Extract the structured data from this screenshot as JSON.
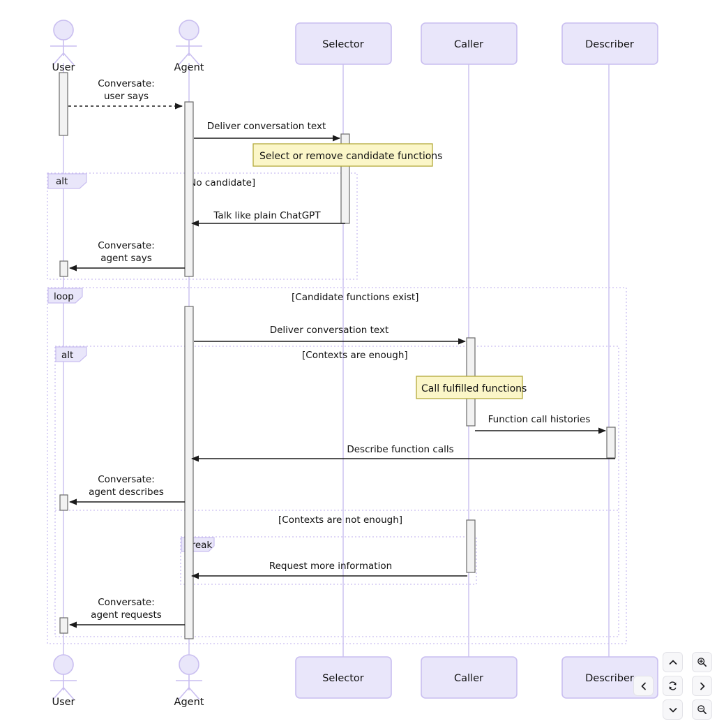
{
  "diagram": {
    "type": "uml-sequence-diagram",
    "colors": {
      "participant_fill": "#e9e6fa",
      "participant_stroke": "#c6bdf0",
      "lifeline_stroke": "#c9bef0",
      "activation_fill": "#f2f2f2",
      "activation_stroke": "#6b6b6b",
      "note_fill": "#fbf6c8",
      "note_stroke": "#b3a93a",
      "fragment_stroke": "#c9bef0",
      "fragment_label_fill": "#e9e6fa",
      "message_stroke": "#1a1a1a",
      "text": "#111111"
    },
    "participants": [
      {
        "name": "User",
        "label": "User",
        "shape": "actor"
      },
      {
        "name": "Agent",
        "label": "Agent",
        "shape": "actor"
      },
      {
        "name": "Selector",
        "label": "Selector",
        "shape": "box"
      },
      {
        "name": "Caller",
        "label": "Caller",
        "shape": "box"
      },
      {
        "name": "Describer",
        "label": "Describer",
        "shape": "box"
      }
    ],
    "messages": [
      {
        "id": "m1",
        "from": "User",
        "to": "Agent",
        "label_line1": "Conversate:",
        "label_line2": "user says",
        "style": "dashed"
      },
      {
        "id": "m2",
        "from": "Agent",
        "to": "Selector",
        "label_line1": "Deliver conversation text",
        "style": "solid"
      },
      {
        "id": "m3",
        "from": "Selector",
        "to": "Agent",
        "label_line1": "Talk like plain ChatGPT",
        "style": "solid"
      },
      {
        "id": "m4",
        "from": "Agent",
        "to": "User",
        "label_line1": "Conversate:",
        "label_line2": "agent says",
        "style": "solid"
      },
      {
        "id": "m5",
        "from": "Agent",
        "to": "Caller",
        "label_line1": "Deliver conversation text",
        "style": "solid"
      },
      {
        "id": "m6",
        "from": "Caller",
        "to": "Describer",
        "label_line1": "Function call histories",
        "style": "solid"
      },
      {
        "id": "m7",
        "from": "Describer",
        "to": "Agent",
        "label_line1": "Describe function calls",
        "style": "solid"
      },
      {
        "id": "m8",
        "from": "Agent",
        "to": "User",
        "label_line1": "Conversate:",
        "label_line2": "agent describes",
        "style": "solid"
      },
      {
        "id": "m9",
        "from": "Caller",
        "to": "Agent",
        "label_line1": "Request more information",
        "style": "solid"
      },
      {
        "id": "m10",
        "from": "Agent",
        "to": "User",
        "label_line1": "Conversate:",
        "label_line2": "agent requests",
        "style": "solid"
      }
    ],
    "notes": [
      {
        "id": "n1",
        "over": "Selector",
        "text": "Select or remove candidate functions"
      },
      {
        "id": "n2",
        "over": "Caller",
        "text": "Call fulfilled functions"
      }
    ],
    "fragments": [
      {
        "id": "f1",
        "keyword": "alt",
        "condition": "[No candidate]"
      },
      {
        "id": "f2",
        "keyword": "loop",
        "condition": "[Candidate functions exist]"
      },
      {
        "id": "f3",
        "keyword": "alt",
        "condition": "[Contexts are enough]"
      },
      {
        "id": "f3b",
        "keyword": "",
        "condition": "[Contexts are not enough]"
      },
      {
        "id": "f4",
        "keyword": "break",
        "condition": ""
      }
    ]
  },
  "nav": {
    "buttons": [
      {
        "name": "pan-up-button",
        "icon": "chevron-up-icon",
        "glyph": "^"
      },
      {
        "name": "zoom-in-button",
        "icon": "zoom-in-icon",
        "glyph": "+"
      },
      {
        "name": "pan-left-button",
        "icon": "chevron-left-icon",
        "glyph": "<"
      },
      {
        "name": "reset-view-button",
        "icon": "refresh-icon",
        "glyph": "refresh"
      },
      {
        "name": "pan-right-button",
        "icon": "chevron-right-icon",
        "glyph": ">"
      },
      {
        "name": "pan-down-button",
        "icon": "chevron-down-icon",
        "glyph": "v"
      },
      {
        "name": "zoom-out-button",
        "icon": "zoom-out-icon",
        "glyph": "-"
      }
    ]
  }
}
